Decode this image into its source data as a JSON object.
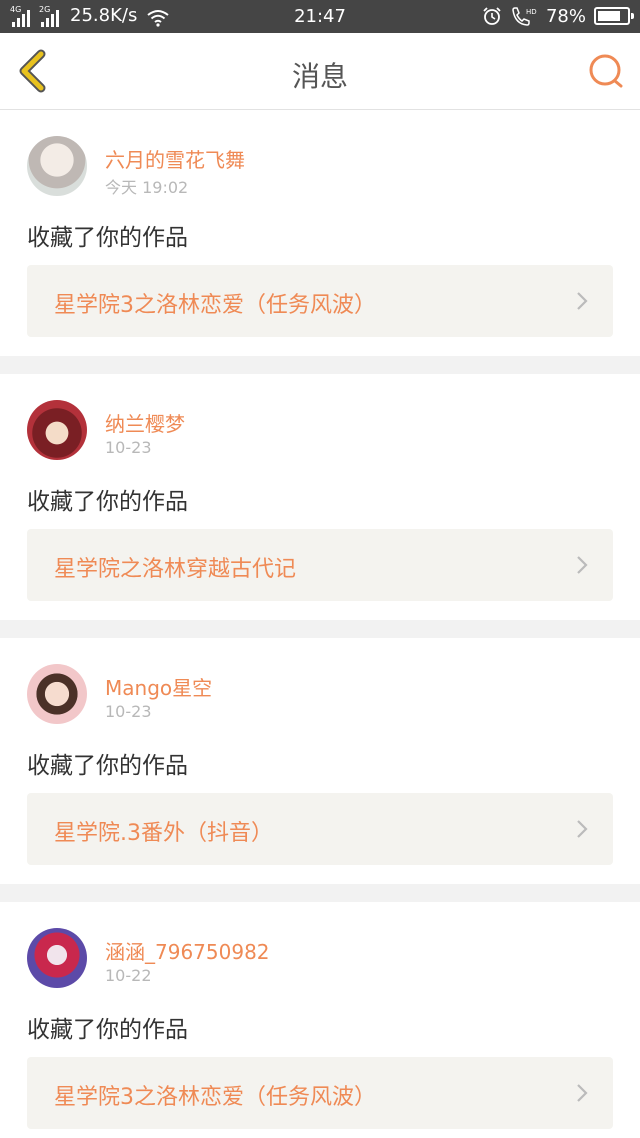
{
  "status_bar": {
    "net1": "4G",
    "net2": "2G",
    "speed": "25.8K/s",
    "time": "21:47",
    "battery": "78%",
    "battery_level": 0.78
  },
  "header": {
    "title": "消息"
  },
  "colors": {
    "accent": "#ef8a55",
    "back": "#e8c21e",
    "card_bg": "#f4f3ef"
  },
  "messages": [
    {
      "user": "六月的雪花飞舞",
      "time": "今天 19:02",
      "action": "收藏了你的作品",
      "work": "星学院3之洛林恋爱（任务风波）"
    },
    {
      "user": "纳兰樱梦",
      "time": "10-23",
      "action": "收藏了你的作品",
      "work": "星学院之洛林穿越古代记"
    },
    {
      "user": "Mango星空",
      "time": "10-23",
      "action": "收藏了你的作品",
      "work": "星学院.3番外（抖音）"
    },
    {
      "user": "涵涵_796750982",
      "time": "10-22",
      "action": "收藏了你的作品",
      "work": "星学院3之洛林恋爱（任务风波）"
    }
  ]
}
